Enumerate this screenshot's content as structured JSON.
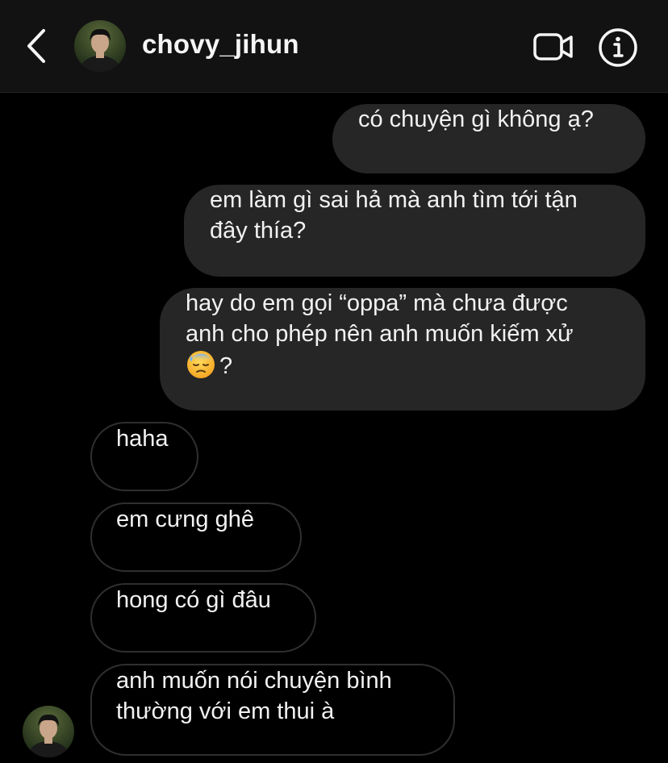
{
  "header": {
    "username": "chovy_jihun",
    "back_icon": "chevron-left-icon",
    "video_icon": "video-camera-icon",
    "info_icon": "info-icon"
  },
  "messages": [
    {
      "direction": "outgoing",
      "lines": [
        "có chuyện gì không ạ?"
      ]
    },
    {
      "direction": "outgoing",
      "lines": [
        "em làm gì sai hả mà anh tìm tới tận",
        "đây thía?"
      ]
    },
    {
      "direction": "outgoing",
      "lines": [
        "hay do em gọi “oppa” mà chưa được",
        "anh cho phép nên anh muốn kiếm xử",
        "?"
      ],
      "emoji": "downcast-face-with-sweat-icon"
    },
    {
      "direction": "incoming",
      "lines": [
        "haha"
      ]
    },
    {
      "direction": "incoming",
      "lines": [
        "em cưng ghê"
      ]
    },
    {
      "direction": "incoming",
      "lines": [
        "hong có gì đâu"
      ]
    },
    {
      "direction": "incoming",
      "lines": [
        "anh muốn nói chuyện bình",
        "thường với em thui à"
      ]
    }
  ],
  "colors": {
    "background": "#000000",
    "header_bg": "#121212",
    "outgoing_bubble": "#262626",
    "incoming_border": "#2f2f2f",
    "text": "#f2f2f2"
  }
}
